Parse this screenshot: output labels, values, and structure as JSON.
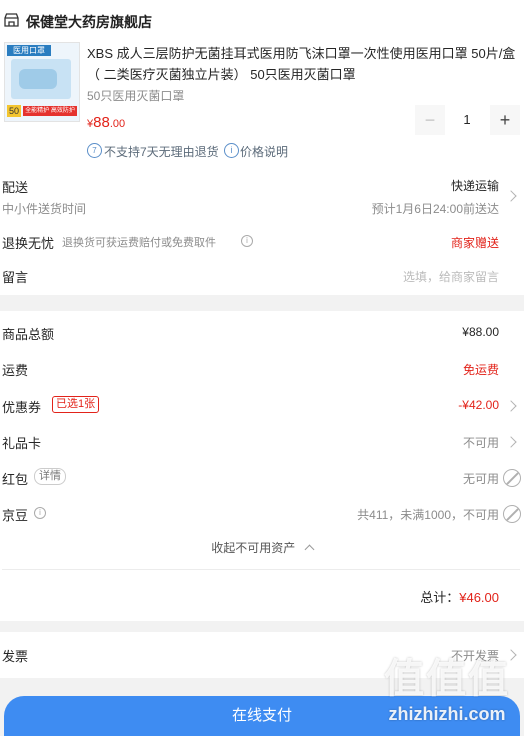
{
  "store": {
    "name": "保健堂大药房旗舰店"
  },
  "product": {
    "thumb_label_top": "医用口罩",
    "thumb_qty": "50",
    "thumb_label_bottom": "全能精护 高效防护",
    "title": "XBS 成人三层防护无菌挂耳式医用防飞沫口罩一次性使用医用口罩 50片/盒（ 二类医疗灭菌独立片装） 50只医用灭菌口罩",
    "spec": "50只医用灭菌口罩",
    "price_symbol": "¥",
    "price_int": "88",
    "price_dec": ".00",
    "quantity": "1",
    "minus_glyph": "−",
    "plus_glyph": "+",
    "no_return": "不支持7天无理由退货",
    "price_note": "价格说明"
  },
  "delivery": {
    "label": "配送",
    "method": "快递运输",
    "sub_label": "中小件送货时间",
    "eta": "预计1月6日24:00前送达"
  },
  "worry_free": {
    "label": "退换无忧",
    "desc": "退换货可获运费赔付或免费取件",
    "value": "商家赠送"
  },
  "message": {
    "label": "留言",
    "placeholder": "选填，给商家留言"
  },
  "summary": {
    "goods_label": "商品总额",
    "goods_value": "¥88.00",
    "freight_label": "运费",
    "freight_value": "免运费",
    "coupon_label": "优惠券",
    "coupon_badge": "已选1张",
    "coupon_value": "-¥42.00",
    "giftcard_label": "礼品卡",
    "giftcard_value": "不可用",
    "redpacket_label": "红包",
    "redpacket_detail": "详情",
    "redpacket_value": "无可用",
    "jingdou_label": "京豆",
    "jingdou_value": "共411，未满1000，不可用",
    "collapse": "收起不可用资产",
    "total_label": "总计：",
    "total_value": "¥46.00"
  },
  "invoice": {
    "label": "发票",
    "value": "不开发票"
  },
  "pay_button": "在线支付",
  "watermark": {
    "glyphs": "值值值",
    "domain": "zhizhizhi.com"
  },
  "colors": {
    "accent": "#e2231a",
    "pay": "#3e8cf2",
    "muted": "#8c8c8c"
  }
}
